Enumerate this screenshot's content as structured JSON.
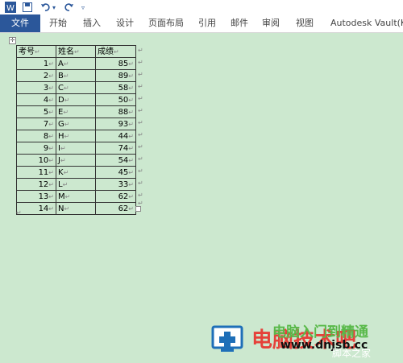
{
  "toolbar": {
    "undo_arrow": "▾",
    "customize": "▿"
  },
  "ribbon": {
    "tabs": [
      "文件",
      "开始",
      "插入",
      "设计",
      "页面布局",
      "引用",
      "邮件",
      "审阅",
      "视图",
      "Autodesk Vault(K)"
    ]
  },
  "table": {
    "headers": [
      "考号",
      "姓名",
      "成绩"
    ],
    "rows": [
      [
        "1",
        "A",
        "85"
      ],
      [
        "2",
        "B",
        "89"
      ],
      [
        "3",
        "C",
        "58"
      ],
      [
        "4",
        "D",
        "50"
      ],
      [
        "5",
        "E",
        "88"
      ],
      [
        "7",
        "G",
        "93"
      ],
      [
        "8",
        "H",
        "44"
      ],
      [
        "9",
        "I",
        "74"
      ],
      [
        "10",
        "J",
        "54"
      ],
      [
        "11",
        "K",
        "45"
      ],
      [
        "12",
        "L",
        "33"
      ],
      [
        "13",
        "M",
        "62"
      ],
      [
        "14",
        "N",
        "62"
      ]
    ]
  },
  "marks": {
    "cell": "↵",
    "move": "✛"
  },
  "watermark": {
    "green": "电脑入门到精通",
    "red": "电脑技术吧",
    "url": "www.dnjsb.cc",
    "script": "脚本之家"
  },
  "colors": {
    "file_tab": "#2b579a",
    "page_bg": "#cce8cf"
  },
  "icons": [
    "word-logo-icon",
    "save-icon",
    "undo-icon",
    "redo-icon",
    "customize-icon"
  ]
}
